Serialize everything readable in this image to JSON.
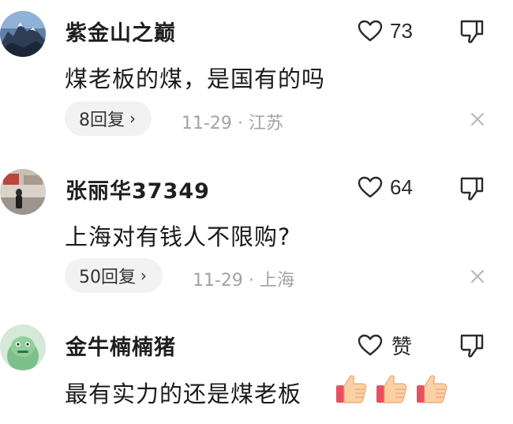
{
  "comments": [
    {
      "username": "紫金山之巅",
      "like_count": "73",
      "text": "煤老板的煤，是国有的吗",
      "replies": "8回复",
      "chevron": "›",
      "date": "11-29",
      "separator": "·",
      "location": "江苏"
    },
    {
      "username": "张丽华37349",
      "like_count": "64",
      "text": "上海对有钱人不限购?",
      "replies": "50回复",
      "chevron": "›",
      "date": "11-29",
      "separator": "·",
      "location": "上海"
    },
    {
      "username": "金牛楠楠猪",
      "like_label": "赞",
      "text": "最有实力的还是煤老板"
    }
  ],
  "icons": {
    "like": "heart-outline-icon",
    "dislike": "thumbs-down-icon",
    "close": "close-icon",
    "emoji": "thumbs-up-emoji"
  },
  "colors": {
    "text": "#1a1a1a",
    "meta": "#a3a3a3",
    "pill_bg": "#f2f2f2"
  }
}
